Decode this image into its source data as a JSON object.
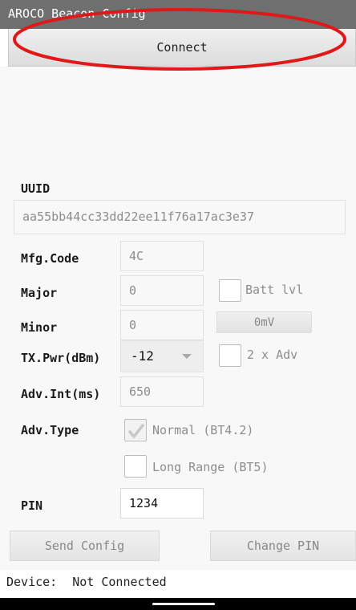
{
  "app": {
    "title": "AROCO Beacon Config"
  },
  "connect_button": {
    "label": "Connect"
  },
  "uuid": {
    "label": "UUID",
    "value": "aa55bb44cc33dd22ee11f76a17ac3e37"
  },
  "mfg_code": {
    "label": "Mfg.Code",
    "value": "4C"
  },
  "major": {
    "label": "Major",
    "value": "0"
  },
  "minor": {
    "label": "Minor",
    "value": "0"
  },
  "batt_lvl": {
    "label": "Batt lvl",
    "checked": false
  },
  "mv_button": {
    "label": "0mV"
  },
  "tx_pwr": {
    "label": "TX.Pwr(dBm)",
    "selected": "-12"
  },
  "two_x_adv": {
    "label": "2 x Adv",
    "checked": false
  },
  "adv_int": {
    "label": "Adv.Int(ms)",
    "value": "650"
  },
  "adv_type": {
    "label": "Adv.Type",
    "normal": {
      "label": "Normal (BT4.2)",
      "checked": true
    },
    "long_range": {
      "label": "Long Range (BT5)",
      "checked": false
    }
  },
  "pin": {
    "label": "PIN",
    "value": "1234"
  },
  "send_config_button": {
    "label": "Send Config"
  },
  "change_pin_button": {
    "label": "Change PIN"
  },
  "status": {
    "label": "Device:",
    "value": "Not Connected"
  },
  "colors": {
    "annotation": "#e01818",
    "title_bar": "#6f6f6f",
    "background": "#f8f8f8"
  },
  "icons": {
    "checkmark": "checkmark-icon",
    "dropdown": "chevron-down-icon"
  }
}
